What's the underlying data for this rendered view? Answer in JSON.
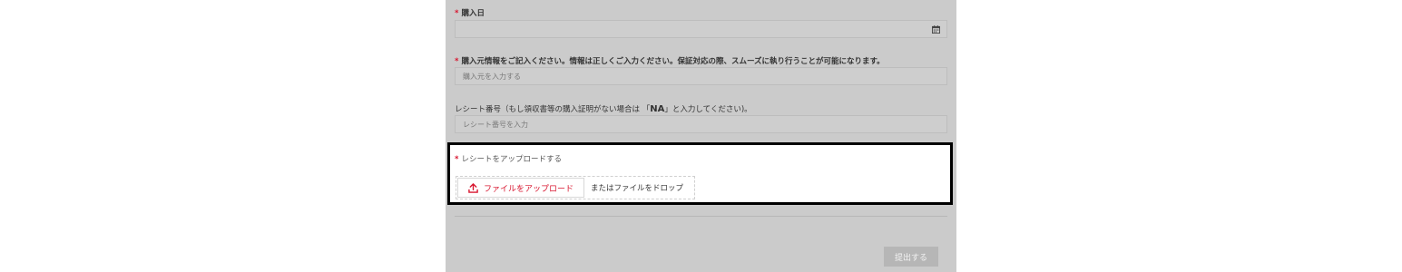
{
  "form": {
    "required_mark": "*",
    "purchase_date": {
      "label": "購入日",
      "value": ""
    },
    "purchase_source": {
      "label": "購入元情報をご記入ください。情報は正しくご入力ください。保証対応の際、スムーズに執り行うことが可能になります。",
      "placeholder": "購入元を入力する"
    },
    "receipt_number": {
      "label_before": "レシート番号（もし領収書等の購入証明がない場合は 「",
      "label_emphasis": "NA",
      "label_after": "」と入力してください)。",
      "placeholder": "レシート番号を入力"
    },
    "receipt_upload": {
      "label": "レシートをアップロードする",
      "button_label": "ファイルをアップロード",
      "drop_text": "またはファイルをドロップ"
    },
    "submit_label": "提出する"
  },
  "icons": {
    "date_field": "calendar-icon",
    "upload_button": "upload-icon"
  },
  "colors": {
    "required": "#d8152f",
    "upload_accent": "#d8152f",
    "panel_bg": "#cbcbcb",
    "submit_bg": "#b6b6b6"
  }
}
